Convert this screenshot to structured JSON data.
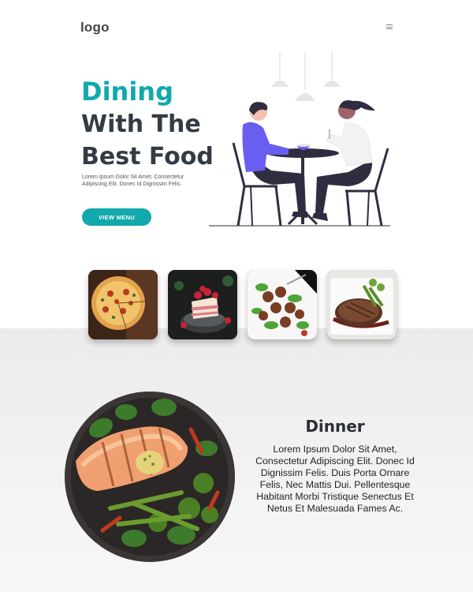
{
  "header": {
    "logo": "logo",
    "menu_icon": "hamburger-menu-icon"
  },
  "hero": {
    "title_line1": "Dining",
    "title_line2": "With The",
    "title_line3": "Best Food",
    "subtitle": "Lorem Ipsum Dolor Sit Amet, Consectetur Adipiscing Elit. Donec Id Dignissim Felis.",
    "cta_label": "VIEW MENU",
    "illustration": "couple-dining-illustration"
  },
  "gallery": {
    "items": [
      {
        "name": "pizza"
      },
      {
        "name": "layer-cake"
      },
      {
        "name": "meatballs"
      },
      {
        "name": "steak"
      }
    ]
  },
  "dinner": {
    "title": "Dinner",
    "text": "Lorem Ipsum Dolor Sit Amet, Consectetur Adipiscing Elit. Donec Id Dignissim Felis. Duis Porta Ornare Felis, Nec Mattis Dui. Pellentesque Habitant Morbi Tristique Senectus Et Netus Et Malesuada Fames Ac.",
    "image": "grilled-salmon-plate"
  },
  "colors": {
    "accent": "#12a8ac",
    "heading": "#333b44",
    "figure_shirt": "#6a5ef2"
  }
}
